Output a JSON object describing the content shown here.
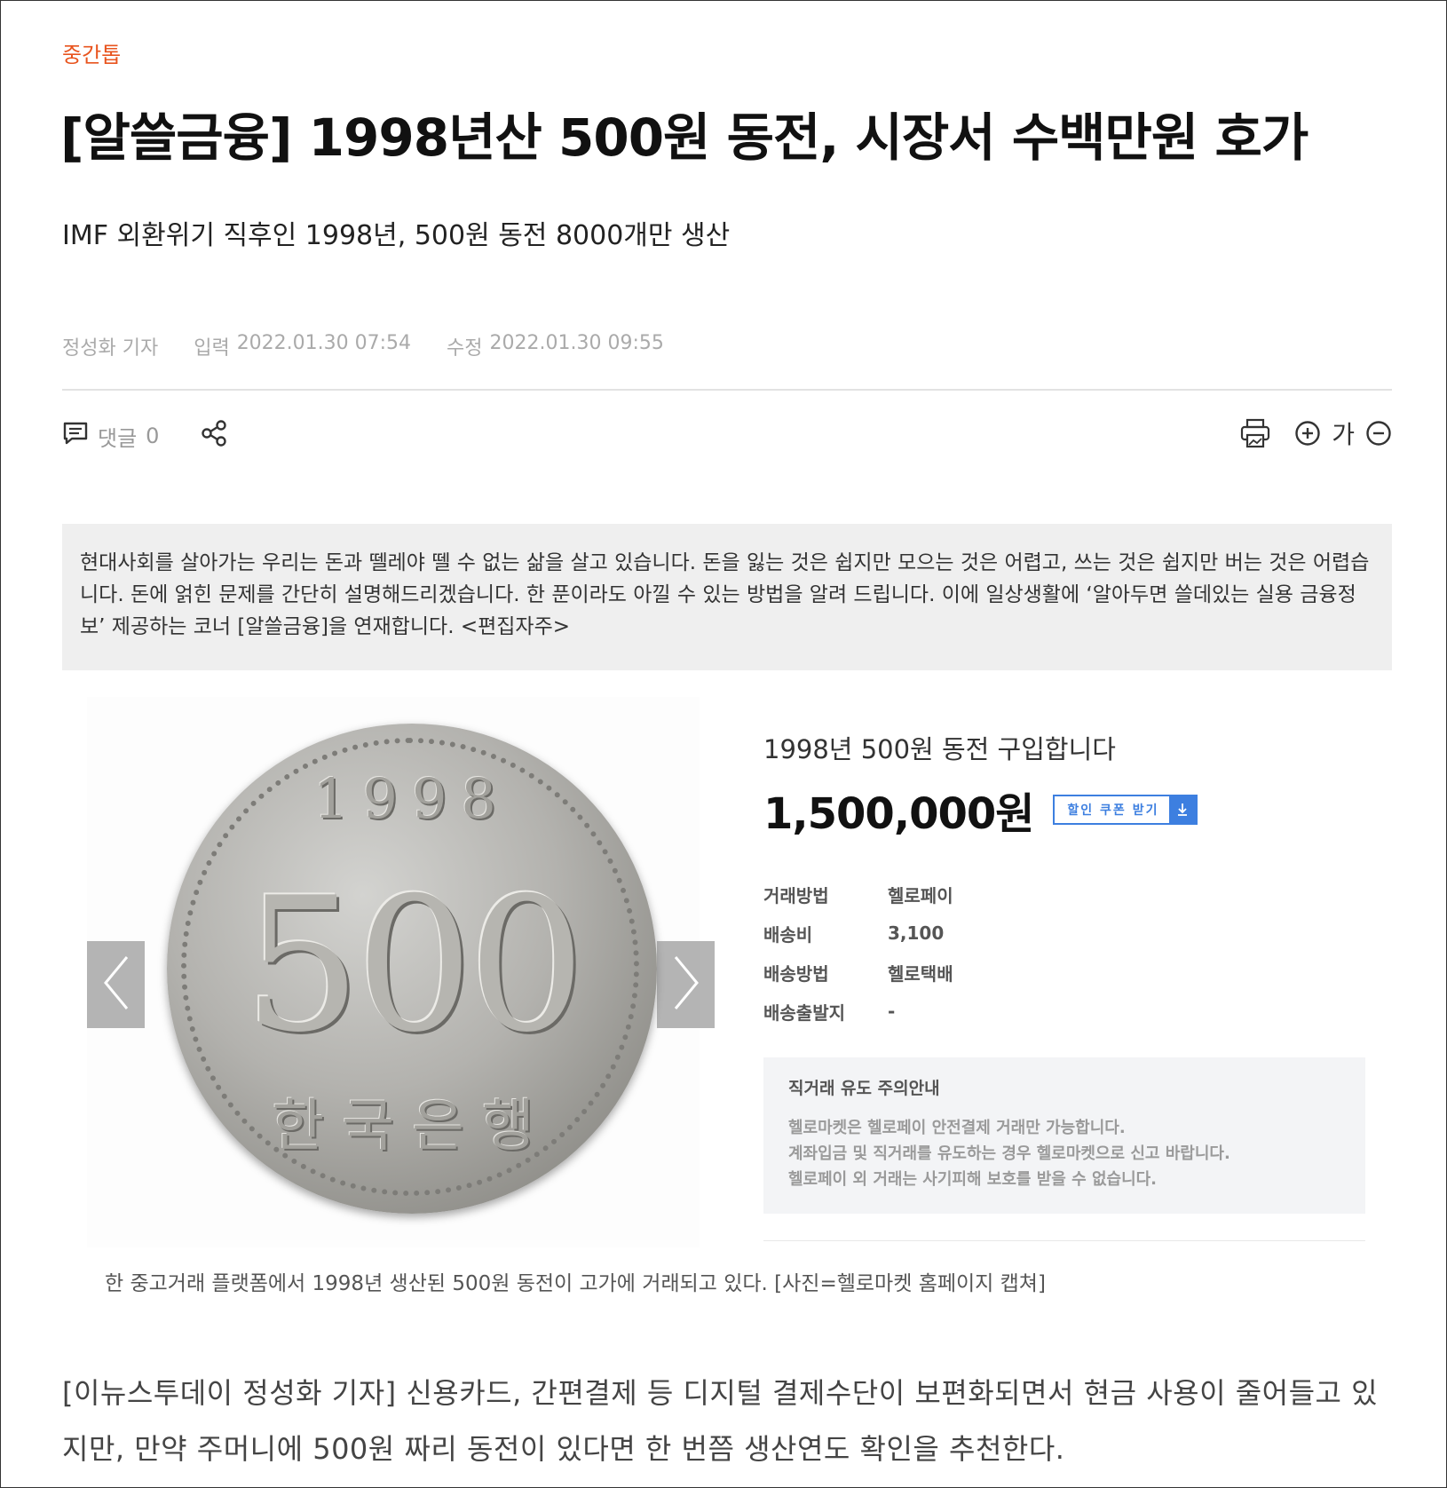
{
  "section_tag": "중간톱",
  "headline": "[알쓸금융] 1998년산 500원 동전, 시장서 수백만원 호가",
  "subheadline": "IMF 외환위기 직후인 1998년, 500원 동전 8000개만 생산",
  "meta": {
    "author": "정성화 기자",
    "input_label": "입력",
    "input_time": "2022.01.30 07:54",
    "edit_label": "수정",
    "edit_time": "2022.01.30 09:55"
  },
  "toolbar": {
    "comment_label": "댓글",
    "comment_count": "0",
    "font_label": "가"
  },
  "editor_note": "현대사회를 살아가는 우리는 돈과 뗄레야 뗄 수 없는 삶을 살고 있습니다. 돈을 잃는 것은 쉽지만 모으는 것은 어렵고, 쓰는 것은 쉽지만 버는 것은 어렵습니다. 돈에 얽힌 문제를 간단히 설명해드리겠습니다. 한 푼이라도 아낄 수 있는 방법을 알려 드립니다. 이에 일상생활에 ‘알아두면 쓸데있는 실용 금융정보’ 제공하는 코너 [알쓸금융]을 연재합니다. <편집자주>",
  "figure": {
    "coin": {
      "year": "1998",
      "value": "500",
      "bank": "한국은행"
    },
    "product": {
      "title": "1998년 500원 동전 구입합니다",
      "price": "1,500,000원",
      "coupon_label": "할인 쿠폰 받기",
      "specs": [
        {
          "key": "거래방법",
          "value": "헬로페이"
        },
        {
          "key": "배송비",
          "value": "3,100"
        },
        {
          "key": "배송방법",
          "value": "헬로택배"
        },
        {
          "key": "배송출발지",
          "value": "-"
        }
      ],
      "notice": {
        "title": "직거래 유도 주의안내",
        "lines": [
          "헬로마켓은 헬로페이 안전결제 거래만 가능합니다.",
          "계좌입금 및 직거래를 유도하는 경우 헬로마켓으로 신고 바랍니다.",
          "헬로페이 외 거래는 사기피해 보호를 받을 수 없습니다."
        ]
      }
    },
    "caption": "한 중고거래 플랫폼에서 1998년 생산된 500원 동전이 고가에 거래되고 있다. [사진=헬로마켓 홈페이지 캡쳐]"
  },
  "body_text": "[이뉴스투데이 정성화 기자] 신용카드, 간편결제 등 디지털 결제수단이 보편화되면서 현금 사용이 줄어들고 있지만, 만약 주머니에 500원 짜리 동전이 있다면 한 번쯤 생산연도 확인을 추천한다.",
  "colors": {
    "accent": "#e8541e",
    "coupon_blue": "#3d7fe0",
    "note_bg": "#efefef"
  },
  "icons": [
    "comment-icon",
    "share-icon",
    "print-icon",
    "zoom-in-icon",
    "zoom-out-icon",
    "chevron-left-icon",
    "chevron-right-icon",
    "download-icon"
  ]
}
